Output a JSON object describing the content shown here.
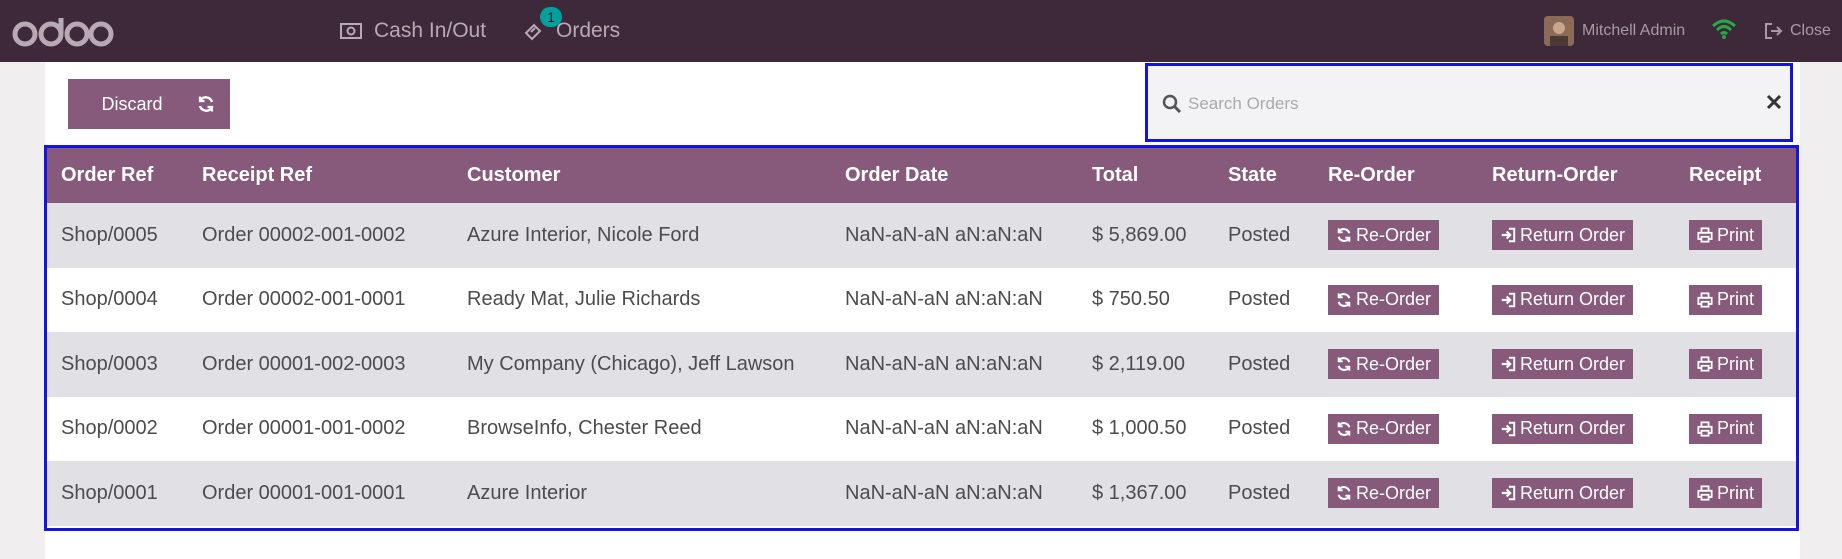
{
  "navbar": {
    "cash_label": "Cash In/Out",
    "orders_label": "Orders",
    "orders_badge": "1",
    "user_name": "Mitchell Admin",
    "close_label": "Close"
  },
  "toolbar": {
    "discard_label": "Discard"
  },
  "search": {
    "placeholder": "Search Orders"
  },
  "table": {
    "columns": [
      "Order Ref",
      "Receipt Ref",
      "Customer",
      "Order Date",
      "Total",
      "State",
      "Re-Order",
      "Return-Order",
      "Receipt"
    ],
    "reorder_label": "Re-Order",
    "return_label": "Return Order",
    "print_label": "Print",
    "rows": [
      {
        "order_ref": "Shop/0005",
        "receipt_ref": "Order 00002-001-0002",
        "customer": "Azure Interior, Nicole Ford",
        "date": "NaN-aN-aN aN:aN:aN",
        "total": "$ 5,869.00",
        "state": "Posted"
      },
      {
        "order_ref": "Shop/0004",
        "receipt_ref": "Order 00002-001-0001",
        "customer": "Ready Mat, Julie Richards",
        "date": "NaN-aN-aN aN:aN:aN",
        "total": "$ 750.50",
        "state": "Posted"
      },
      {
        "order_ref": "Shop/0003",
        "receipt_ref": "Order 00001-002-0003",
        "customer": "My Company (Chicago), Jeff Lawson",
        "date": "NaN-aN-aN aN:aN:aN",
        "total": "$ 2,119.00",
        "state": "Posted"
      },
      {
        "order_ref": "Shop/0002",
        "receipt_ref": "Order 00001-001-0002",
        "customer": "BrowseInfo, Chester Reed",
        "date": "NaN-aN-aN aN:aN:aN",
        "total": "$ 1,000.50",
        "state": "Posted"
      },
      {
        "order_ref": "Shop/0001",
        "receipt_ref": "Order 00001-001-0001",
        "customer": "Azure Interior",
        "date": "NaN-aN-aN aN:aN:aN",
        "total": "$ 1,367.00",
        "state": "Posted"
      }
    ]
  },
  "colors": {
    "topbar": "#3d2939",
    "accent": "#875a7b",
    "focus_outline": "#1414e0",
    "badge": "#00a09d",
    "wifi": "#28a745"
  },
  "icons": [
    "odoo-logo",
    "money-icon",
    "ticket-icon",
    "wifi-icon",
    "sign-out-icon",
    "refresh-icon",
    "search-icon",
    "close-icon",
    "sign-in-icon",
    "print-icon"
  ]
}
